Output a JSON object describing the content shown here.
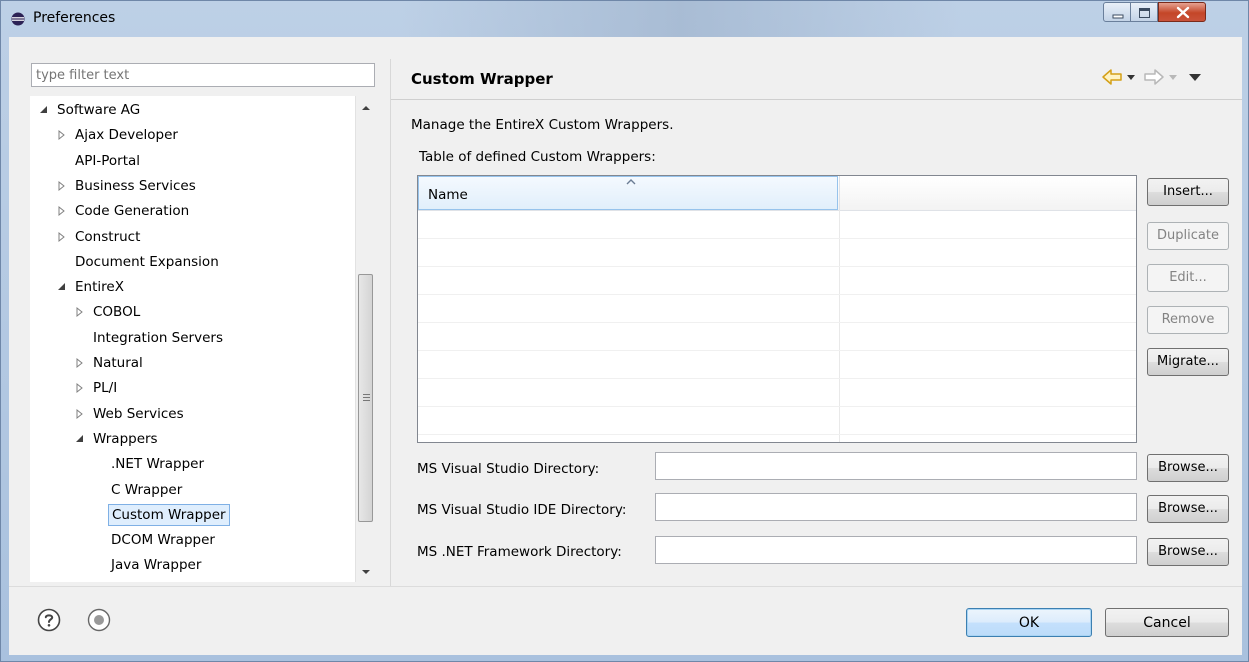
{
  "window": {
    "title": "Preferences",
    "controls": {
      "minimize": "minimize-icon",
      "maximize": "maximize-icon",
      "close": "close-icon"
    }
  },
  "filter": {
    "placeholder": "type filter text",
    "value": ""
  },
  "tree": {
    "items": [
      {
        "label": "Software AG",
        "depth": 0,
        "state": "expanded"
      },
      {
        "label": "Ajax Developer",
        "depth": 1,
        "state": "collapsed"
      },
      {
        "label": "API-Portal",
        "depth": 1,
        "state": "leaf"
      },
      {
        "label": "Business Services",
        "depth": 1,
        "state": "collapsed"
      },
      {
        "label": "Code Generation",
        "depth": 1,
        "state": "collapsed"
      },
      {
        "label": "Construct",
        "depth": 1,
        "state": "collapsed"
      },
      {
        "label": "Document Expansion",
        "depth": 1,
        "state": "leaf"
      },
      {
        "label": "EntireX",
        "depth": 1,
        "state": "expanded"
      },
      {
        "label": "COBOL",
        "depth": 2,
        "state": "collapsed"
      },
      {
        "label": "Integration Servers",
        "depth": 2,
        "state": "leaf"
      },
      {
        "label": "Natural",
        "depth": 2,
        "state": "collapsed"
      },
      {
        "label": "PL/I",
        "depth": 2,
        "state": "collapsed"
      },
      {
        "label": "Web Services",
        "depth": 2,
        "state": "collapsed"
      },
      {
        "label": "Wrappers",
        "depth": 2,
        "state": "expanded"
      },
      {
        "label": ".NET Wrapper",
        "depth": 3,
        "state": "leaf"
      },
      {
        "label": "C Wrapper",
        "depth": 3,
        "state": "leaf"
      },
      {
        "label": "Custom Wrapper",
        "depth": 3,
        "state": "leaf",
        "selected": true
      },
      {
        "label": "DCOM Wrapper",
        "depth": 3,
        "state": "leaf"
      },
      {
        "label": "Java Wrapper",
        "depth": 3,
        "state": "leaf"
      }
    ]
  },
  "page": {
    "title": "Custom Wrapper",
    "description": "Manage the EntireX Custom Wrappers.",
    "table_label": "Table of defined Custom Wrappers:",
    "table": {
      "columns": [
        "Name",
        ""
      ],
      "rows": []
    },
    "buttons": {
      "insert": "Insert...",
      "duplicate": "Duplicate",
      "edit": "Edit...",
      "remove": "Remove",
      "migrate": "Migrate..."
    },
    "fields": [
      {
        "label": "MS Visual Studio Directory:",
        "value": "",
        "browse": "Browse..."
      },
      {
        "label": "MS Visual Studio IDE Directory:",
        "value": "",
        "browse": "Browse..."
      },
      {
        "label": "MS .NET Framework Directory:",
        "value": "",
        "browse": "Browse..."
      }
    ]
  },
  "footer": {
    "ok": "OK",
    "cancel": "Cancel"
  },
  "colors": {
    "accent": "#3c7fb1",
    "selection": "#dfeefd",
    "nav_arrow": "#d4a017"
  }
}
